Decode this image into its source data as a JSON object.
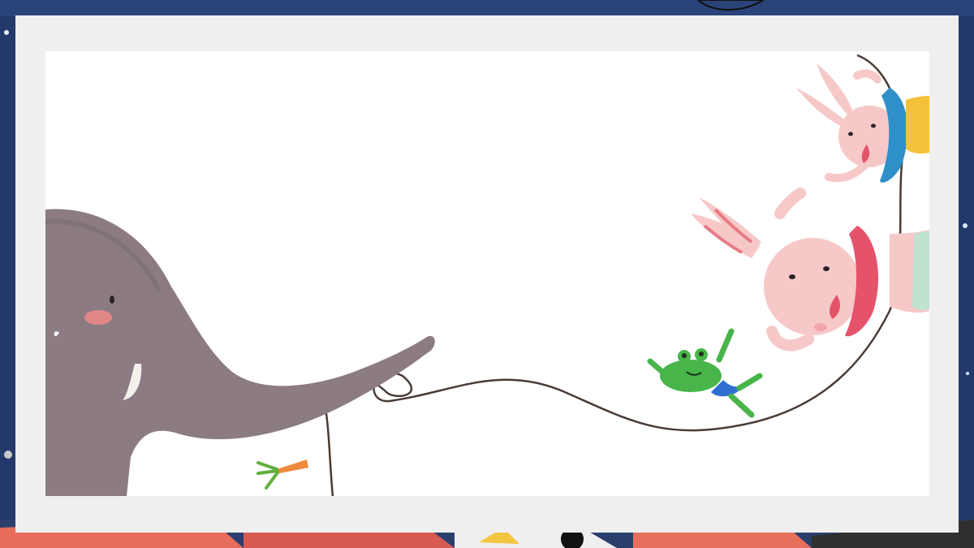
{
  "slide": {
    "background_color": "#23396b",
    "frame_color": "#efefef",
    "canvas_color": "#ffffff",
    "accent_colors": {
      "elephant": "#8c7b83",
      "elephant_cheek": "#f08a8a",
      "rope": "#4a3b36",
      "carrot": "#f08a3c",
      "carrot_leaf": "#5fae3c",
      "frog": "#48b54b",
      "frog_shorts": "#2f6fd1",
      "bunny": "#f7c8c8",
      "bunny_ear_inner": "#e77b84",
      "bunny_ruff_blue": "#2f8fc9",
      "bunny_ruff_red": "#e5536a",
      "bunny_pants_yellow": "#f4c23a",
      "bunny_pants_mint": "#bfe3cf"
    },
    "illustration": {
      "scene": "elephant-swinging-jump-rope",
      "characters": [
        "elephant",
        "frog",
        "bunny",
        "bunny"
      ]
    }
  }
}
